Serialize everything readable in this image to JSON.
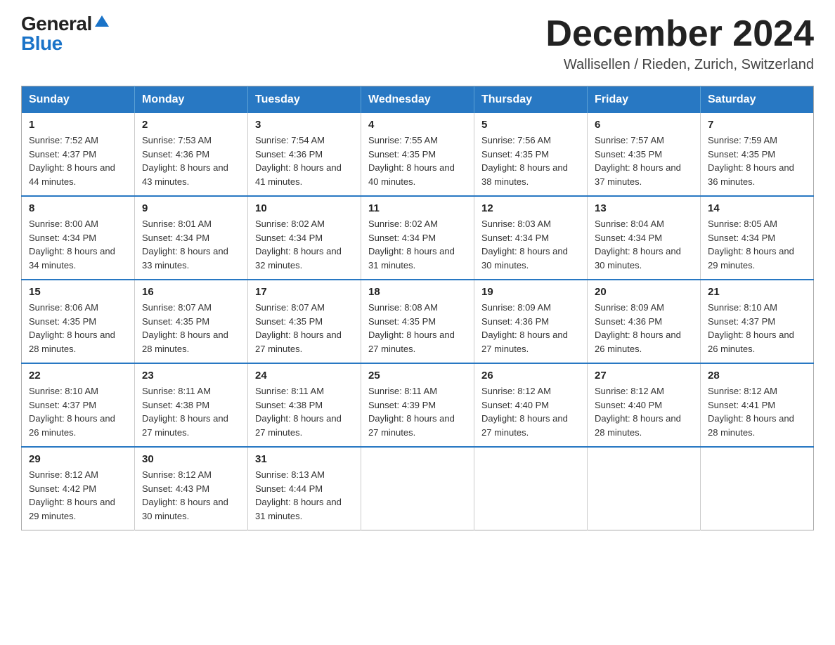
{
  "logo": {
    "general": "General",
    "blue": "Blue",
    "alt": "GeneralBlue logo"
  },
  "title": {
    "month": "December 2024",
    "location": "Wallisellen / Rieden, Zurich, Switzerland"
  },
  "weekdays": [
    "Sunday",
    "Monday",
    "Tuesday",
    "Wednesday",
    "Thursday",
    "Friday",
    "Saturday"
  ],
  "weeks": [
    [
      {
        "day": "1",
        "sunrise": "Sunrise: 7:52 AM",
        "sunset": "Sunset: 4:37 PM",
        "daylight": "Daylight: 8 hours and 44 minutes."
      },
      {
        "day": "2",
        "sunrise": "Sunrise: 7:53 AM",
        "sunset": "Sunset: 4:36 PM",
        "daylight": "Daylight: 8 hours and 43 minutes."
      },
      {
        "day": "3",
        "sunrise": "Sunrise: 7:54 AM",
        "sunset": "Sunset: 4:36 PM",
        "daylight": "Daylight: 8 hours and 41 minutes."
      },
      {
        "day": "4",
        "sunrise": "Sunrise: 7:55 AM",
        "sunset": "Sunset: 4:35 PM",
        "daylight": "Daylight: 8 hours and 40 minutes."
      },
      {
        "day": "5",
        "sunrise": "Sunrise: 7:56 AM",
        "sunset": "Sunset: 4:35 PM",
        "daylight": "Daylight: 8 hours and 38 minutes."
      },
      {
        "day": "6",
        "sunrise": "Sunrise: 7:57 AM",
        "sunset": "Sunset: 4:35 PM",
        "daylight": "Daylight: 8 hours and 37 minutes."
      },
      {
        "day": "7",
        "sunrise": "Sunrise: 7:59 AM",
        "sunset": "Sunset: 4:35 PM",
        "daylight": "Daylight: 8 hours and 36 minutes."
      }
    ],
    [
      {
        "day": "8",
        "sunrise": "Sunrise: 8:00 AM",
        "sunset": "Sunset: 4:34 PM",
        "daylight": "Daylight: 8 hours and 34 minutes."
      },
      {
        "day": "9",
        "sunrise": "Sunrise: 8:01 AM",
        "sunset": "Sunset: 4:34 PM",
        "daylight": "Daylight: 8 hours and 33 minutes."
      },
      {
        "day": "10",
        "sunrise": "Sunrise: 8:02 AM",
        "sunset": "Sunset: 4:34 PM",
        "daylight": "Daylight: 8 hours and 32 minutes."
      },
      {
        "day": "11",
        "sunrise": "Sunrise: 8:02 AM",
        "sunset": "Sunset: 4:34 PM",
        "daylight": "Daylight: 8 hours and 31 minutes."
      },
      {
        "day": "12",
        "sunrise": "Sunrise: 8:03 AM",
        "sunset": "Sunset: 4:34 PM",
        "daylight": "Daylight: 8 hours and 30 minutes."
      },
      {
        "day": "13",
        "sunrise": "Sunrise: 8:04 AM",
        "sunset": "Sunset: 4:34 PM",
        "daylight": "Daylight: 8 hours and 30 minutes."
      },
      {
        "day": "14",
        "sunrise": "Sunrise: 8:05 AM",
        "sunset": "Sunset: 4:34 PM",
        "daylight": "Daylight: 8 hours and 29 minutes."
      }
    ],
    [
      {
        "day": "15",
        "sunrise": "Sunrise: 8:06 AM",
        "sunset": "Sunset: 4:35 PM",
        "daylight": "Daylight: 8 hours and 28 minutes."
      },
      {
        "day": "16",
        "sunrise": "Sunrise: 8:07 AM",
        "sunset": "Sunset: 4:35 PM",
        "daylight": "Daylight: 8 hours and 28 minutes."
      },
      {
        "day": "17",
        "sunrise": "Sunrise: 8:07 AM",
        "sunset": "Sunset: 4:35 PM",
        "daylight": "Daylight: 8 hours and 27 minutes."
      },
      {
        "day": "18",
        "sunrise": "Sunrise: 8:08 AM",
        "sunset": "Sunset: 4:35 PM",
        "daylight": "Daylight: 8 hours and 27 minutes."
      },
      {
        "day": "19",
        "sunrise": "Sunrise: 8:09 AM",
        "sunset": "Sunset: 4:36 PM",
        "daylight": "Daylight: 8 hours and 27 minutes."
      },
      {
        "day": "20",
        "sunrise": "Sunrise: 8:09 AM",
        "sunset": "Sunset: 4:36 PM",
        "daylight": "Daylight: 8 hours and 26 minutes."
      },
      {
        "day": "21",
        "sunrise": "Sunrise: 8:10 AM",
        "sunset": "Sunset: 4:37 PM",
        "daylight": "Daylight: 8 hours and 26 minutes."
      }
    ],
    [
      {
        "day": "22",
        "sunrise": "Sunrise: 8:10 AM",
        "sunset": "Sunset: 4:37 PM",
        "daylight": "Daylight: 8 hours and 26 minutes."
      },
      {
        "day": "23",
        "sunrise": "Sunrise: 8:11 AM",
        "sunset": "Sunset: 4:38 PM",
        "daylight": "Daylight: 8 hours and 27 minutes."
      },
      {
        "day": "24",
        "sunrise": "Sunrise: 8:11 AM",
        "sunset": "Sunset: 4:38 PM",
        "daylight": "Daylight: 8 hours and 27 minutes."
      },
      {
        "day": "25",
        "sunrise": "Sunrise: 8:11 AM",
        "sunset": "Sunset: 4:39 PM",
        "daylight": "Daylight: 8 hours and 27 minutes."
      },
      {
        "day": "26",
        "sunrise": "Sunrise: 8:12 AM",
        "sunset": "Sunset: 4:40 PM",
        "daylight": "Daylight: 8 hours and 27 minutes."
      },
      {
        "day": "27",
        "sunrise": "Sunrise: 8:12 AM",
        "sunset": "Sunset: 4:40 PM",
        "daylight": "Daylight: 8 hours and 28 minutes."
      },
      {
        "day": "28",
        "sunrise": "Sunrise: 8:12 AM",
        "sunset": "Sunset: 4:41 PM",
        "daylight": "Daylight: 8 hours and 28 minutes."
      }
    ],
    [
      {
        "day": "29",
        "sunrise": "Sunrise: 8:12 AM",
        "sunset": "Sunset: 4:42 PM",
        "daylight": "Daylight: 8 hours and 29 minutes."
      },
      {
        "day": "30",
        "sunrise": "Sunrise: 8:12 AM",
        "sunset": "Sunset: 4:43 PM",
        "daylight": "Daylight: 8 hours and 30 minutes."
      },
      {
        "day": "31",
        "sunrise": "Sunrise: 8:13 AM",
        "sunset": "Sunset: 4:44 PM",
        "daylight": "Daylight: 8 hours and 31 minutes."
      },
      null,
      null,
      null,
      null
    ]
  ]
}
